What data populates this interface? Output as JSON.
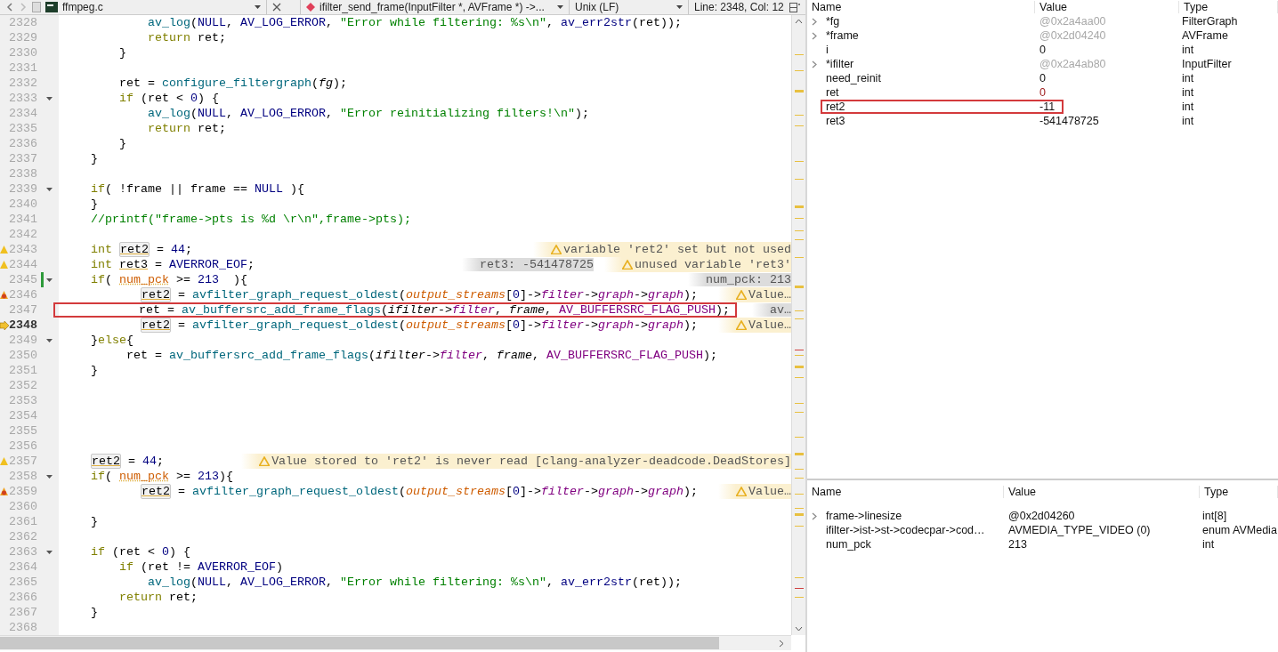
{
  "editor": {
    "toolbar": {
      "file": "ffmpeg.c",
      "symbol": "ifilter_send_frame(InputFilter *, AVFrame *) ->...",
      "line_ending": "Unix (LF)",
      "position": "Line: 2348, Col: 12"
    },
    "lines": [
      {
        "number": "2328",
        "kind": "plain",
        "fold": false,
        "modified": false,
        "boxed": false,
        "tokens": [
          {
            "kind": "function",
            "text": "            av_log"
          },
          {
            "kind": "plain",
            "text": "("
          },
          {
            "kind": "macro",
            "text": "NULL"
          },
          {
            "kind": "plain",
            "text": ", "
          },
          {
            "kind": "macro",
            "text": "AV_LOG_ERROR"
          },
          {
            "kind": "plain",
            "text": ", "
          },
          {
            "kind": "string",
            "text": "\"Error while filtering: %s\\n\""
          },
          {
            "kind": "plain",
            "text": ", "
          },
          {
            "kind": "macro",
            "text": "av_err2str"
          },
          {
            "kind": "plain",
            "text": "(ret));"
          }
        ]
      },
      {
        "number": "2329",
        "kind": "plain",
        "fold": false,
        "modified": false,
        "boxed": false,
        "tokens": [
          {
            "kind": "keyword",
            "text": "            return"
          },
          {
            "kind": "plain",
            "text": " ret;"
          }
        ]
      },
      {
        "number": "2330",
        "kind": "plain",
        "fold": false,
        "modified": false,
        "boxed": false,
        "tokens": [
          {
            "kind": "plain",
            "text": "        }"
          }
        ]
      },
      {
        "number": "2331",
        "kind": "plain",
        "fold": false,
        "modified": false,
        "boxed": false
      },
      {
        "number": "2332",
        "kind": "plain",
        "fold": false,
        "modified": false,
        "boxed": false,
        "tokens": [
          {
            "kind": "plain",
            "text": "        ret = "
          },
          {
            "kind": "function",
            "text": "configure_filtergraph"
          },
          {
            "kind": "plain",
            "text": "("
          },
          {
            "kind": "param",
            "text": "fg"
          },
          {
            "kind": "plain",
            "text": ");"
          }
        ]
      },
      {
        "number": "2333",
        "kind": "plain",
        "fold": true,
        "modified": false,
        "boxed": false,
        "tokens": [
          {
            "kind": "keyword",
            "text": "        if"
          },
          {
            "kind": "plain",
            "text": " (ret < "
          },
          {
            "kind": "number",
            "text": "0"
          },
          {
            "kind": "plain",
            "text": ") {"
          }
        ]
      },
      {
        "number": "2334",
        "kind": "plain",
        "fold": false,
        "modified": false,
        "boxed": false,
        "tokens": [
          {
            "kind": "function",
            "text": "            av_log"
          },
          {
            "kind": "plain",
            "text": "("
          },
          {
            "kind": "macro",
            "text": "NULL"
          },
          {
            "kind": "plain",
            "text": ", "
          },
          {
            "kind": "macro",
            "text": "AV_LOG_ERROR"
          },
          {
            "kind": "plain",
            "text": ", "
          },
          {
            "kind": "string",
            "text": "\"Error reinitializing filters!\\n\""
          },
          {
            "kind": "plain",
            "text": ");"
          }
        ]
      },
      {
        "number": "2335",
        "kind": "plain",
        "fold": false,
        "modified": false,
        "boxed": false,
        "tokens": [
          {
            "kind": "keyword",
            "text": "            return"
          },
          {
            "kind": "plain",
            "text": " ret;"
          }
        ]
      },
      {
        "number": "2336",
        "kind": "plain",
        "fold": false,
        "modified": false,
        "boxed": false,
        "tokens": [
          {
            "kind": "plain",
            "text": "        }"
          }
        ]
      },
      {
        "number": "2337",
        "kind": "plain",
        "fold": false,
        "modified": false,
        "boxed": false,
        "tokens": [
          {
            "kind": "plain",
            "text": "    }"
          }
        ]
      },
      {
        "number": "2338",
        "kind": "plain",
        "fold": false,
        "modified": false,
        "boxed": false
      },
      {
        "number": "2339",
        "kind": "plain",
        "fold": true,
        "modified": false,
        "boxed": false,
        "tokens": [
          {
            "kind": "keyword",
            "text": "    if"
          },
          {
            "kind": "plain",
            "text": "( !frame || frame == "
          },
          {
            "kind": "macro",
            "text": "NULL"
          },
          {
            "kind": "plain",
            "text": " ){"
          }
        ]
      },
      {
        "number": "2340",
        "kind": "plain",
        "fold": false,
        "modified": false,
        "boxed": false,
        "tokens": [
          {
            "kind": "plain",
            "text": "    }"
          }
        ]
      },
      {
        "number": "2341",
        "kind": "plain",
        "fold": false,
        "modified": false,
        "boxed": false,
        "tokens": [
          {
            "kind": "comment",
            "text": "    //printf(\"frame->pts is %d \\r\\n\",frame->pts);"
          }
        ]
      },
      {
        "number": "2342",
        "kind": "plain",
        "fold": false,
        "modified": false,
        "boxed": false
      },
      {
        "number": "2343",
        "kind": "warning",
        "fold": false,
        "modified": false,
        "boxed": false,
        "tokens": [
          {
            "kind": "keyword",
            "text": "    int"
          },
          {
            "kind": "occurrence",
            "text": " ret2"
          },
          {
            "kind": "plain",
            "text": " = "
          },
          {
            "kind": "number",
            "text": "44"
          },
          {
            "kind": "plain",
            "text": ";"
          }
        ],
        "annotations": [
          {
            "kind": "warning",
            "text": "variable 'ret2' set but not used"
          }
        ]
      },
      {
        "number": "2344",
        "kind": "warning",
        "fold": false,
        "modified": false,
        "boxed": false,
        "tokens": [
          {
            "kind": "keyword",
            "text": "    int"
          },
          {
            "kind": "unused",
            "text": " ret3"
          },
          {
            "kind": "plain",
            "text": " = "
          },
          {
            "kind": "macro",
            "text": "AVERROR_EOF"
          },
          {
            "kind": "plain",
            "text": ";"
          }
        ],
        "annotations": [
          {
            "kind": "value",
            "text": "ret3: -541478725"
          },
          {
            "kind": "warning",
            "text": "unused variable 'ret3'"
          }
        ]
      },
      {
        "number": "2345",
        "kind": "plain",
        "fold": true,
        "modified": true,
        "boxed": false,
        "tokens": [
          {
            "kind": "keyword",
            "text": "    if"
          },
          {
            "kind": "plain",
            "text": "( "
          },
          {
            "kind": "global",
            "text": "num_pck"
          },
          {
            "kind": "plain",
            "text": " >= "
          },
          {
            "kind": "number",
            "text": "213"
          },
          {
            "kind": "plain",
            "text": "  ){"
          }
        ],
        "annotations": [
          {
            "kind": "value",
            "text": "num_pck: 213"
          }
        ]
      },
      {
        "number": "2346",
        "kind": "error",
        "fold": false,
        "modified": false,
        "boxed": false,
        "tokens": [
          {
            "kind": "occurrence",
            "text": "           ret2"
          },
          {
            "kind": "plain",
            "text": " = "
          },
          {
            "kind": "function",
            "text": "avfilter_graph_request_oldest"
          },
          {
            "kind": "plain",
            "text": "("
          },
          {
            "kind": "global_italic",
            "text": "output_streams"
          },
          {
            "kind": "plain",
            "text": "["
          },
          {
            "kind": "number",
            "text": "0"
          },
          {
            "kind": "plain",
            "text": "]->"
          },
          {
            "kind": "field",
            "text": "filter"
          },
          {
            "kind": "plain",
            "text": "->"
          },
          {
            "kind": "field",
            "text": "graph"
          },
          {
            "kind": "plain",
            "text": "->"
          },
          {
            "kind": "field",
            "text": "graph"
          },
          {
            "kind": "plain",
            "text": ");"
          }
        ],
        "annotations": [
          {
            "kind": "warning",
            "text": "Value…"
          }
        ]
      },
      {
        "number": "2347",
        "kind": "plain",
        "fold": false,
        "modified": false,
        "boxed": true,
        "tokens": [
          {
            "kind": "plain",
            "text": "           ret = "
          },
          {
            "kind": "function",
            "text": "av_buffersrc_add_frame_flags"
          },
          {
            "kind": "plain",
            "text": "("
          },
          {
            "kind": "param",
            "text": "ifilter"
          },
          {
            "kind": "plain",
            "text": "->"
          },
          {
            "kind": "field",
            "text": "filter"
          },
          {
            "kind": "plain",
            "text": ", "
          },
          {
            "kind": "param",
            "text": "frame"
          },
          {
            "kind": "plain",
            "text": ", "
          },
          {
            "kind": "enum",
            "text": "AV_BUFFERSRC_FLAG_PUSH"
          },
          {
            "kind": "plain",
            "text": ");"
          }
        ],
        "annotations": [
          {
            "kind": "value",
            "text": "av…"
          }
        ]
      },
      {
        "number": "2348",
        "kind": "current",
        "fold": false,
        "modified": false,
        "boxed": false,
        "tokens": [
          {
            "kind": "occurrence",
            "text": "           ret2"
          },
          {
            "kind": "plain",
            "text": " = "
          },
          {
            "kind": "function",
            "text": "avfilter_graph_request_oldest"
          },
          {
            "kind": "plain",
            "text": "("
          },
          {
            "kind": "global_italic",
            "text": "output_streams"
          },
          {
            "kind": "plain",
            "text": "["
          },
          {
            "kind": "number",
            "text": "0"
          },
          {
            "kind": "plain",
            "text": "]->"
          },
          {
            "kind": "field",
            "text": "filter"
          },
          {
            "kind": "plain",
            "text": "->"
          },
          {
            "kind": "field",
            "text": "graph"
          },
          {
            "kind": "plain",
            "text": "->"
          },
          {
            "kind": "field",
            "text": "graph"
          },
          {
            "kind": "plain",
            "text": ");"
          }
        ],
        "annotations": [
          {
            "kind": "warning",
            "text": "Value…"
          }
        ]
      },
      {
        "number": "2349",
        "kind": "plain",
        "fold": true,
        "modified": false,
        "boxed": false,
        "tokens": [
          {
            "kind": "plain",
            "text": "    }"
          },
          {
            "kind": "keyword",
            "text": "else"
          },
          {
            "kind": "plain",
            "text": "{"
          }
        ]
      },
      {
        "number": "2350",
        "kind": "plain",
        "fold": false,
        "modified": false,
        "boxed": false,
        "tokens": [
          {
            "kind": "plain",
            "text": "         ret = "
          },
          {
            "kind": "function",
            "text": "av_buffersrc_add_frame_flags"
          },
          {
            "kind": "plain",
            "text": "("
          },
          {
            "kind": "param",
            "text": "ifilter"
          },
          {
            "kind": "plain",
            "text": "->"
          },
          {
            "kind": "field",
            "text": "filter"
          },
          {
            "kind": "plain",
            "text": ", "
          },
          {
            "kind": "param",
            "text": "frame"
          },
          {
            "kind": "plain",
            "text": ", "
          },
          {
            "kind": "enum",
            "text": "AV_BUFFERSRC_FLAG_PUSH"
          },
          {
            "kind": "plain",
            "text": ");"
          }
        ]
      },
      {
        "number": "2351",
        "kind": "plain",
        "fold": false,
        "modified": false,
        "boxed": false,
        "tokens": [
          {
            "kind": "plain",
            "text": "    }"
          }
        ]
      },
      {
        "number": "2352",
        "kind": "plain",
        "fold": false,
        "modified": false,
        "boxed": false
      },
      {
        "number": "2353",
        "kind": "plain",
        "fold": false,
        "modified": false,
        "boxed": false
      },
      {
        "number": "2354",
        "kind": "plain",
        "fold": false,
        "modified": false,
        "boxed": false
      },
      {
        "number": "2355",
        "kind": "plain",
        "fold": false,
        "modified": false,
        "boxed": false
      },
      {
        "number": "2356",
        "kind": "plain",
        "fold": false,
        "modified": false,
        "boxed": false
      },
      {
        "number": "2357",
        "kind": "warning",
        "fold": false,
        "modified": false,
        "boxed": false,
        "tokens": [
          {
            "kind": "occurrence",
            "text": "    ret2"
          },
          {
            "kind": "plain",
            "text": " = "
          },
          {
            "kind": "number",
            "text": "44"
          },
          {
            "kind": "plain",
            "text": ";"
          }
        ],
        "annotations": [
          {
            "kind": "warning",
            "text": "Value stored to 'ret2' is never read [clang-analyzer-deadcode.DeadStores]"
          }
        ]
      },
      {
        "number": "2358",
        "kind": "plain",
        "fold": true,
        "modified": false,
        "boxed": false,
        "tokens": [
          {
            "kind": "keyword",
            "text": "    if"
          },
          {
            "kind": "plain",
            "text": "( "
          },
          {
            "kind": "global",
            "text": "num_pck"
          },
          {
            "kind": "plain",
            "text": " >= "
          },
          {
            "kind": "number",
            "text": "213"
          },
          {
            "kind": "plain",
            "text": "){"
          }
        ]
      },
      {
        "number": "2359",
        "kind": "error",
        "fold": false,
        "modified": false,
        "boxed": false,
        "tokens": [
          {
            "kind": "occurrence",
            "text": "           ret2"
          },
          {
            "kind": "plain",
            "text": " = "
          },
          {
            "kind": "function",
            "text": "avfilter_graph_request_oldest"
          },
          {
            "kind": "plain",
            "text": "("
          },
          {
            "kind": "global_italic",
            "text": "output_streams"
          },
          {
            "kind": "plain",
            "text": "["
          },
          {
            "kind": "number",
            "text": "0"
          },
          {
            "kind": "plain",
            "text": "]->"
          },
          {
            "kind": "field",
            "text": "filter"
          },
          {
            "kind": "plain",
            "text": "->"
          },
          {
            "kind": "field",
            "text": "graph"
          },
          {
            "kind": "plain",
            "text": "->"
          },
          {
            "kind": "field",
            "text": "graph"
          },
          {
            "kind": "plain",
            "text": ");"
          }
        ],
        "annotations": [
          {
            "kind": "warning",
            "text": "Value…"
          }
        ]
      },
      {
        "number": "2360",
        "kind": "plain",
        "fold": false,
        "modified": false,
        "boxed": false
      },
      {
        "number": "2361",
        "kind": "plain",
        "fold": false,
        "modified": false,
        "boxed": false,
        "tokens": [
          {
            "kind": "plain",
            "text": "    }"
          }
        ]
      },
      {
        "number": "2362",
        "kind": "plain",
        "fold": false,
        "modified": false,
        "boxed": false
      },
      {
        "number": "2363",
        "kind": "plain",
        "fold": true,
        "modified": false,
        "boxed": false,
        "tokens": [
          {
            "kind": "keyword",
            "text": "    if"
          },
          {
            "kind": "plain",
            "text": " (ret < "
          },
          {
            "kind": "number",
            "text": "0"
          },
          {
            "kind": "plain",
            "text": ") {"
          }
        ]
      },
      {
        "number": "2364",
        "kind": "plain",
        "fold": false,
        "modified": false,
        "boxed": false,
        "tokens": [
          {
            "kind": "keyword",
            "text": "        if"
          },
          {
            "kind": "plain",
            "text": " (ret != "
          },
          {
            "kind": "macro",
            "text": "AVERROR_EOF"
          },
          {
            "kind": "plain",
            "text": ")"
          }
        ]
      },
      {
        "number": "2365",
        "kind": "plain",
        "fold": false,
        "modified": false,
        "boxed": false,
        "tokens": [
          {
            "kind": "function",
            "text": "            av_log"
          },
          {
            "kind": "plain",
            "text": "("
          },
          {
            "kind": "macro",
            "text": "NULL"
          },
          {
            "kind": "plain",
            "text": ", "
          },
          {
            "kind": "macro",
            "text": "AV_LOG_ERROR"
          },
          {
            "kind": "plain",
            "text": ", "
          },
          {
            "kind": "string",
            "text": "\"Error while filtering: %s\\n\""
          },
          {
            "kind": "plain",
            "text": ", "
          },
          {
            "kind": "macro",
            "text": "av_err2str"
          },
          {
            "kind": "plain",
            "text": "(ret));"
          }
        ]
      },
      {
        "number": "2366",
        "kind": "plain",
        "fold": false,
        "modified": false,
        "boxed": false,
        "tokens": [
          {
            "kind": "keyword",
            "text": "        return"
          },
          {
            "kind": "plain",
            "text": " ret;"
          }
        ]
      },
      {
        "number": "2367",
        "kind": "plain",
        "fold": false,
        "modified": false,
        "boxed": false,
        "tokens": [
          {
            "kind": "plain",
            "text": "    }"
          }
        ]
      },
      {
        "number": "2368",
        "kind": "plain",
        "fold": false,
        "modified": false,
        "boxed": false
      }
    ]
  },
  "locals": {
    "columns": [
      "Name",
      "Value",
      "Type"
    ],
    "rows": [
      {
        "name": "*fg",
        "value": "@0x2a4aa00",
        "type": "FilterGraph",
        "expandable": true,
        "dimmed": true,
        "changed": false,
        "boxed": false
      },
      {
        "name": "*frame",
        "value": "@0x2d04240",
        "type": "AVFrame",
        "expandable": true,
        "dimmed": true,
        "changed": false,
        "boxed": false
      },
      {
        "name": "i",
        "value": "0",
        "type": "int",
        "expandable": false,
        "dimmed": false,
        "changed": false,
        "boxed": false
      },
      {
        "name": "*ifilter",
        "value": "@0x2a4ab80",
        "type": "InputFilter",
        "expandable": true,
        "dimmed": true,
        "changed": false,
        "boxed": false
      },
      {
        "name": "need_reinit",
        "value": "0",
        "type": "int",
        "expandable": false,
        "dimmed": false,
        "changed": false,
        "boxed": false
      },
      {
        "name": "ret",
        "value": "0",
        "type": "int",
        "expandable": false,
        "dimmed": false,
        "changed": true,
        "boxed": false
      },
      {
        "name": "ret2",
        "value": "-11",
        "type": "int",
        "expandable": false,
        "dimmed": false,
        "changed": false,
        "boxed": true
      },
      {
        "name": "ret3",
        "value": "-541478725",
        "type": "int",
        "expandable": false,
        "dimmed": false,
        "changed": false,
        "boxed": false
      }
    ]
  },
  "expressions": {
    "columns": [
      "Name",
      "Value",
      "Type"
    ],
    "rows": [
      {
        "name": "frame->linesize",
        "value": "@0x2d04260",
        "type": "int[8]",
        "expandable": true,
        "dimmed": false,
        "changed": false,
        "boxed": false
      },
      {
        "name": "ifilter->ist->st->codecpar->cod…",
        "value": "AVMEDIA_TYPE_VIDEO (0)",
        "type": "enum AVMedia",
        "expandable": false,
        "dimmed": false,
        "changed": false,
        "boxed": false
      },
      {
        "name": "num_pck",
        "value": "213",
        "type": "int",
        "expandable": false,
        "dimmed": false,
        "changed": false,
        "boxed": false
      }
    ]
  }
}
